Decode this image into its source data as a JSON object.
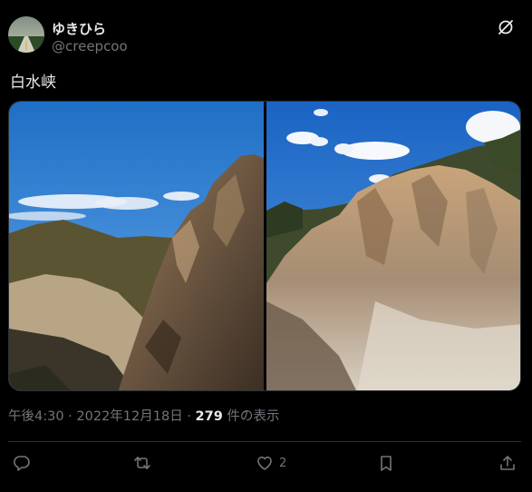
{
  "author": {
    "display_name": "ゆきひら",
    "handle": "@creepcoo"
  },
  "post": {
    "text": "白水峡"
  },
  "meta": {
    "time": "午後4:30",
    "separator": "·",
    "date": "2022年12月18日",
    "views_count": "279",
    "views_label": "件の表示"
  },
  "actions": {
    "reply_count": "",
    "repost_count": "",
    "like_count": "2",
    "bookmark_count": ""
  },
  "icons": [
    "x-logo-icon",
    "reply-icon",
    "repost-icon",
    "like-icon",
    "bookmark-icon",
    "share-icon"
  ],
  "colors": {
    "background": "#000000",
    "primary_text": "#e7e9ea",
    "secondary_text": "#71767b",
    "border": "#2f3336"
  }
}
